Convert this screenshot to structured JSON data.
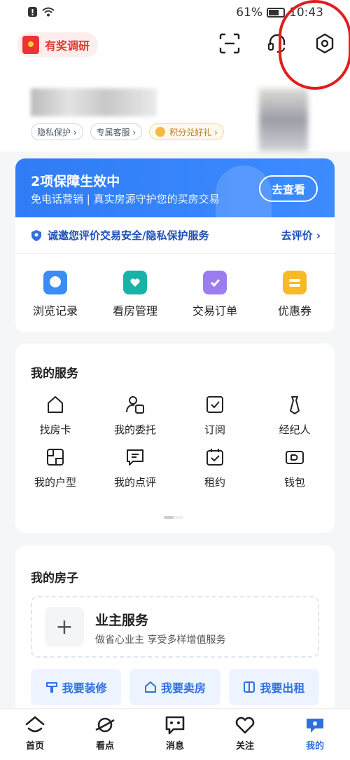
{
  "status_bar": {
    "battery": "61%",
    "time": "10:43"
  },
  "header": {
    "survey_label": "有奖调研",
    "pills": [
      "隐私保护 ›",
      "专属客服 ›",
      "积分兑好礼 ›"
    ]
  },
  "banner": {
    "title": "2项保障生效中",
    "subtitle": "免电话营销 | 真实房源守护您的买房交易",
    "button": "去查看"
  },
  "invite": {
    "text": "诚邀您评价交易安全/隐私保护服务",
    "action": "去评价 ›"
  },
  "quick": [
    {
      "label": "浏览记录",
      "color": "#3b8cf5"
    },
    {
      "label": "看房管理",
      "color": "#18b3a6"
    },
    {
      "label": "交易订单",
      "color": "#9b7cf1"
    },
    {
      "label": "优惠券",
      "color": "#f7b928"
    }
  ],
  "services": {
    "title": "我的服务",
    "items": [
      "找房卡",
      "我的委托",
      "订阅",
      "经纪人",
      "我的户型",
      "我的点评",
      "租约",
      "钱包"
    ]
  },
  "house": {
    "title": "我的房子",
    "owner_title": "业主服务",
    "owner_sub": "做省心业主 享受多样增值服务",
    "plus": "+",
    "actions": [
      "我要装修",
      "我要卖房",
      "我要出租"
    ]
  },
  "tabbar": [
    "首页",
    "看点",
    "消息",
    "关注",
    "我的"
  ]
}
